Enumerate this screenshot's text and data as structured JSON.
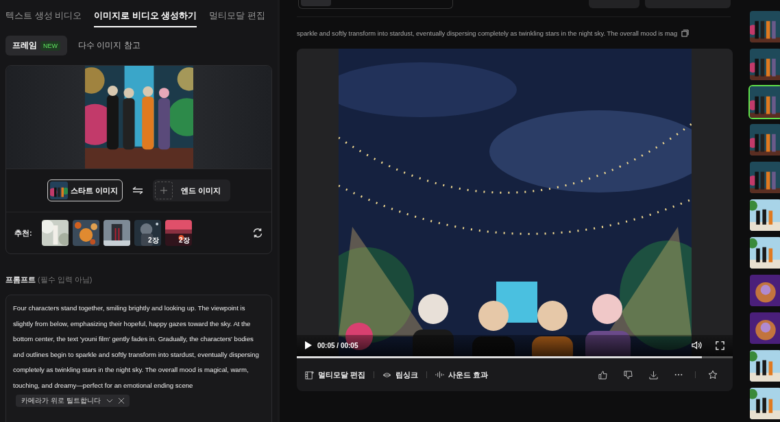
{
  "mode_tabs": [
    {
      "label": "텍스트 생성 비디오",
      "selected": false
    },
    {
      "label": "이미지로 비디오 생성하기",
      "selected": true
    },
    {
      "label": "멀티모달 편집",
      "selected": false
    }
  ],
  "sub_tabs": [
    {
      "label": "프레임",
      "badge": "NEW",
      "selected": true
    },
    {
      "label": "다수 이미지 참고",
      "selected": false
    }
  ],
  "frame": {
    "start_label": "스타트 이미지",
    "end_label": "엔드 이미지"
  },
  "recommend": {
    "label": "추천:",
    "items": [
      {
        "kind": "picture"
      },
      {
        "kind": "picture"
      },
      {
        "kind": "picture"
      },
      {
        "kind": "picture",
        "badge": "2장"
      },
      {
        "kind": "picture",
        "badge": "2장"
      }
    ]
  },
  "prompt": {
    "title": "프롬프트",
    "hint": "(필수 입력 아님)",
    "text": "Four characters stand together, smiling brightly and looking up. The viewpoint is slightly from below, emphasizing their hopeful, happy gazes toward the sky. At the bottom center, the text 'youni film' gently fades in. Gradually, the characters' bodies and outlines begin to sparkle and softly transform into stardust, eventually dispersing completely as twinkling stars in the night sky. The overall mood is magical, warm, touching, and dreamy—perfect for an emotional ending scene",
    "chip": "카메라가 위로 틸트합니다"
  },
  "video": {
    "caption": "sparkle and softly transform into stardust, eventually dispersing completely as twinkling stars in the night sky. The overall mood is mag",
    "time": "00:05 / 00:05",
    "level": 0.93
  },
  "actions": [
    {
      "kind": "edit",
      "label": "멀티모달 편집"
    },
    {
      "kind": "lipsync",
      "label": "립싱크"
    },
    {
      "kind": "sound",
      "label": "사운드 효과"
    }
  ],
  "thumbnails": [
    {
      "selected": false
    },
    {
      "selected": false
    },
    {
      "selected": true
    },
    {
      "selected": false
    },
    {
      "selected": false
    },
    {
      "selected": false
    },
    {
      "selected": false
    },
    {
      "selected": false
    },
    {
      "selected": false
    },
    {
      "selected": false
    },
    {
      "selected": false
    }
  ]
}
